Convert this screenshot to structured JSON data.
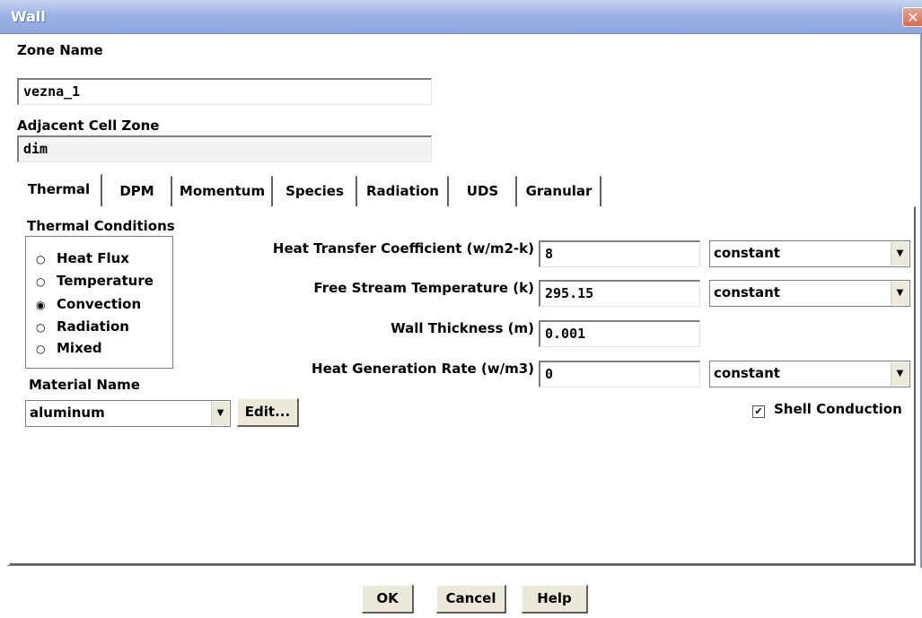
{
  "window": {
    "title": "Wall",
    "close_glyph": "✕"
  },
  "zone": {
    "label": "Zone Name",
    "value": "vezna_1"
  },
  "adjacent": {
    "label": "Adjacent Cell Zone",
    "value": "dim"
  },
  "tabs": [
    "Thermal",
    "DPM",
    "Momentum",
    "Species",
    "Radiation",
    "UDS",
    "Granular"
  ],
  "thermal": {
    "conditions_label": "Thermal Conditions",
    "options": [
      {
        "label": "Heat Flux",
        "selected": false
      },
      {
        "label": "Temperature",
        "selected": false
      },
      {
        "label": "Convection",
        "selected": true
      },
      {
        "label": "Radiation",
        "selected": false
      },
      {
        "label": "Mixed",
        "selected": false
      }
    ],
    "material_label": "Material Name",
    "material_value": "aluminum",
    "edit_label": "Edit...",
    "htc": {
      "label": "Heat Transfer Coefficient (w/m2-k)",
      "value": "8",
      "profile": "constant"
    },
    "fst": {
      "label": "Free Stream Temperature (k)",
      "value": "295.15",
      "profile": "constant"
    },
    "wt": {
      "label": "Wall Thickness (m)",
      "value": "0.001"
    },
    "hgr": {
      "label": "Heat Generation Rate (w/m3)",
      "value": "0",
      "profile": "constant"
    },
    "shell": {
      "label": "Shell Conduction",
      "checked": true
    }
  },
  "buttons": {
    "ok": "OK",
    "cancel": "Cancel",
    "help": "Help"
  },
  "icons": {
    "dropdown": "▼",
    "radio_on": "◉",
    "radio_off": "○",
    "check": "✔"
  },
  "colors": {
    "title_bar": "#8ea6e0",
    "close_button": "#d76a4e",
    "panel": "#ffffff"
  }
}
